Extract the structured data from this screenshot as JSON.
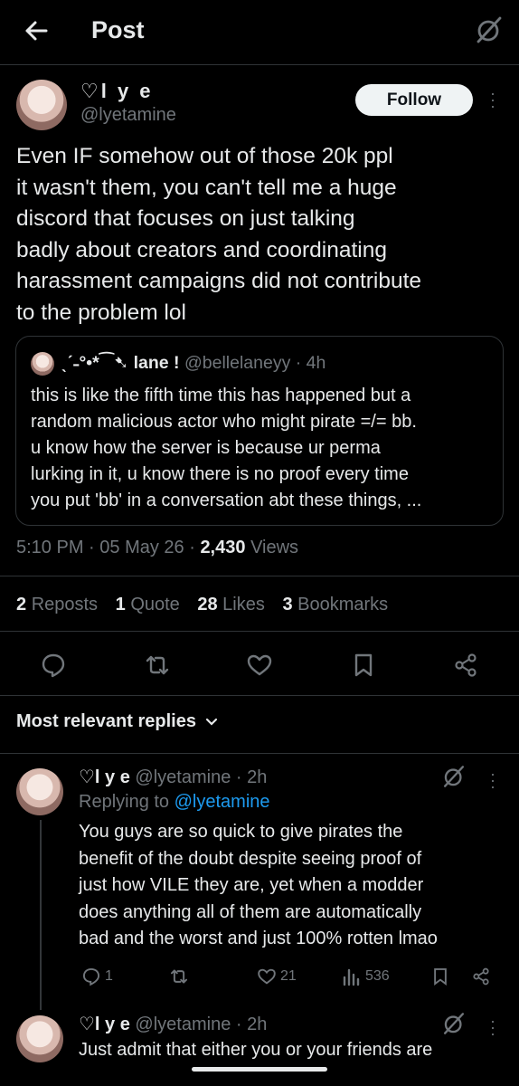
{
  "header": {
    "title": "Post",
    "back_icon": "arrow-left-icon",
    "right_icon": "grok-slash-icon"
  },
  "post": {
    "author_name": "♡l y e",
    "author_handle": "@lyetamine",
    "follow_label": "Follow",
    "text": "Even IF somehow out of those 20k ppl\nit wasn't them, you can't tell me a huge\ndiscord that focuses on just talking\nbadly about creators and coordinating\nharassment campaigns did not contribute\nto the problem lol",
    "quote": {
      "name": "ˎˊ˗°•*⁀➷ lane !",
      "handle": "@bellelaneyy",
      "age": "· 4h",
      "text": "this is like the fifth time this has happened but a\nrandom malicious actor who might pirate =/= bb.\nu know how the server is because ur perma\nlurking in it, u know there is no proof every time\nyou put 'bb' in a conversation abt these things, ..."
    },
    "time": "5:10 PM",
    "date": "· 05 May 26 ·",
    "views_count": "2,430",
    "views_label": "Views",
    "stats": {
      "reposts_count": "2",
      "reposts_label": "Reposts",
      "quotes_count": "1",
      "quotes_label": "Quote",
      "likes_count": "28",
      "likes_label": "Likes",
      "bookmarks_count": "3",
      "bookmarks_label": "Bookmarks"
    }
  },
  "replies_header": "Most relevant replies",
  "replies": [
    {
      "name": "♡l y e",
      "handle": "@lyetamine",
      "age": "· 2h",
      "replying_label": "Replying to",
      "replying_to": "@lyetamine",
      "text": "You guys are so quick to give pirates the\nbenefit of the doubt despite seeing proof of\njust how VILE they are, yet when a modder\ndoes anything all of them are automatically\nbad and the worst and just 100% rotten lmao",
      "reply_count": "1",
      "like_count": "21",
      "view_count": "536"
    },
    {
      "name": "♡l y e",
      "handle": "@lyetamine",
      "age": "· 2h",
      "text": "Just admit that either you or your friends are"
    }
  ],
  "colors": {
    "background": "#000000",
    "text": "#e7e9ea",
    "muted": "#71767b",
    "link": "#1d9bf0",
    "border": "#2f3336"
  }
}
